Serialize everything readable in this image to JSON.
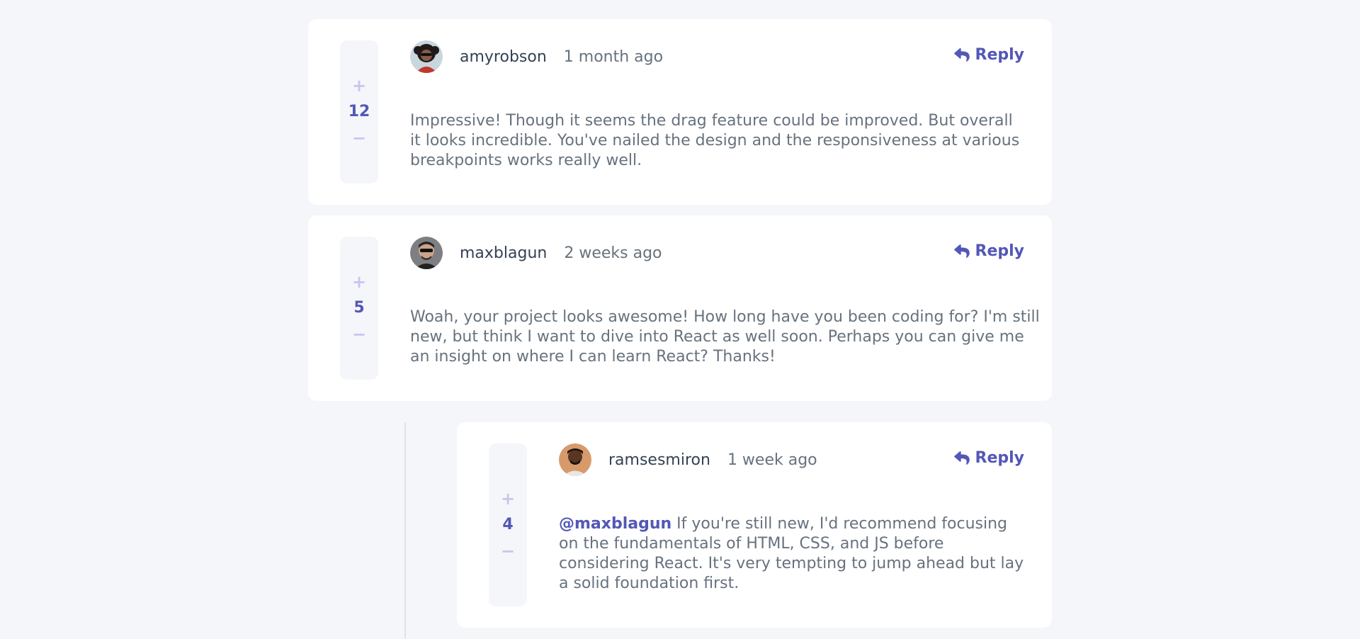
{
  "comments": [
    {
      "username": "amyrobson",
      "time": "1 month ago",
      "score": "12",
      "reply_label": "Reply",
      "content": "Impressive! Though it seems the drag feature could be improved. But overall it looks incredible. You've nailed the design and the responsiveness at various breakpoints works really well."
    },
    {
      "username": "maxblagun",
      "time": "2 weeks ago",
      "score": "5",
      "reply_label": "Reply",
      "content": "Woah, your project looks awesome! How long have you been coding for? I'm still new, but think I want to dive into React as well soon. Perhaps you can give me an insight on where I can learn React? Thanks!"
    },
    {
      "username": "ramsesmiron",
      "time": "1 week ago",
      "score": "4",
      "reply_label": "Reply",
      "mention": "@maxblagun",
      "content": "If you're still new, I'd recommend focusing on the fundamentals of HTML, CSS, and JS before considering React. It's very tempting to jump ahead but lay a solid foundation first."
    }
  ],
  "vote": {
    "plus": "+",
    "minus": "−"
  },
  "icons": {
    "reply": "reply-arrow-icon",
    "upvote": "plus-icon",
    "downvote": "minus-icon"
  },
  "colors": {
    "background": "#f5f6fa",
    "card": "#ffffff",
    "accent": "#5357b6",
    "light_accent": "#c5c6ef",
    "username": "#334253",
    "body_text": "#67727e"
  }
}
